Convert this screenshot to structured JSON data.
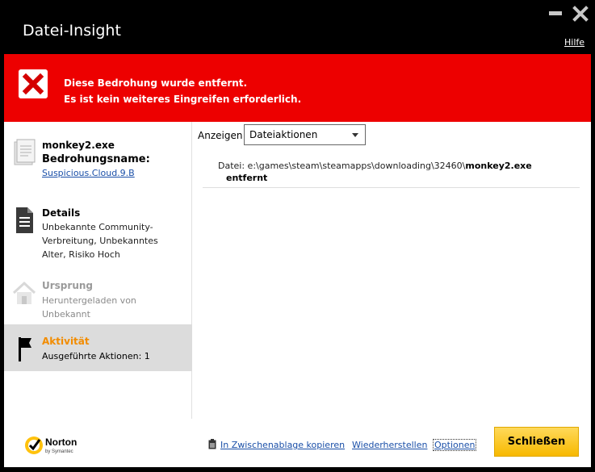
{
  "window": {
    "title": "Datei-Insight",
    "help_label": "Hilfe"
  },
  "banner": {
    "line1": "Diese Bedrohung wurde entfernt.",
    "line2": "Es ist kein weiteres Eingreifen erforderlich.",
    "color": "#ed0000"
  },
  "sidebar": {
    "file": {
      "name": "monkey2.exe",
      "threat_label": "Bedrohungsname:",
      "threat_link": "Suspicious.Cloud.9.B",
      "icon": "document-icon"
    },
    "details": {
      "title": "Details",
      "line1": "Unbekannte Community-",
      "line2": "Verbreitung,  Unbekanntes",
      "line3": "Alter,  Risiko Hoch",
      "icon": "document-lines-icon"
    },
    "origin": {
      "title": "Ursprung",
      "line1": "Heruntergeladen von",
      "line2": "Unbekannt",
      "icon": "house-icon"
    },
    "activity": {
      "title": "Aktivität",
      "line1": "Ausgeführte Aktionen: 1",
      "icon": "flag-icon",
      "accent": "#f28c00"
    }
  },
  "main": {
    "show_label": "Anzeigen",
    "show_select": "Dateiaktionen",
    "file_prefix": "Datei: e:\\games\\steam\\steamapps\\downloading\\32460\\",
    "file_name": "monkey2.exe",
    "status": "entfernt"
  },
  "footer": {
    "brand": "Norton",
    "brand_sub": "by Symantec",
    "copy_label": "In Zwischenablage kopieren",
    "restore_label": "Wiederherstellen",
    "options_label": "Optionen",
    "close_label": "Schließen",
    "close_color": "#f7b900"
  }
}
